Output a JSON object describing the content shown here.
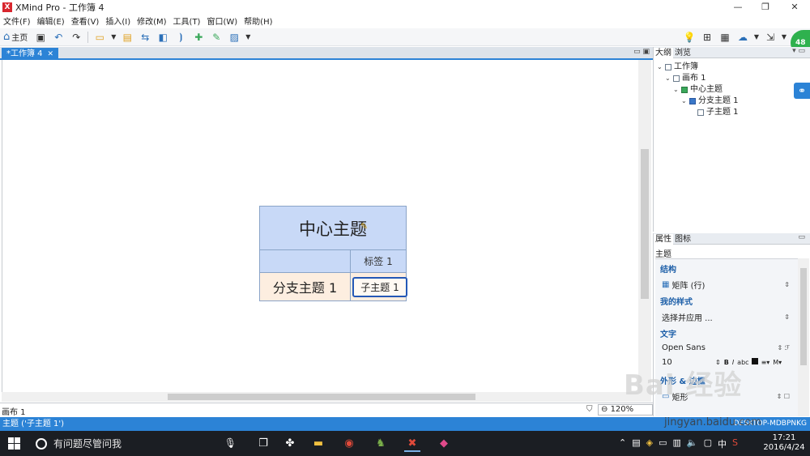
{
  "window": {
    "title": "XMind Pro - 工作簿 4",
    "logo": "X",
    "minimize": "—",
    "maximize": "❐",
    "close": "✕"
  },
  "menu": [
    "文件(F)",
    "编辑(E)",
    "查看(V)",
    "插入(I)",
    "修改(M)",
    "工具(T)",
    "窗口(W)",
    "帮助(H)"
  ],
  "toolbar": {
    "home_label": "主页",
    "badge": "48"
  },
  "editor": {
    "tab_label": "*工作簿 4",
    "central_topic": "中心主题",
    "label": "标签 1",
    "branch_topic": "分支主题 1",
    "sub_topic": "子主题 1"
  },
  "sheetbar": {
    "sheet": "画布 1",
    "zoom": "120%"
  },
  "status": {
    "text": "主题 ('子主题 1')",
    "right": "DESKTOP-MDBPNKG"
  },
  "outline": {
    "tab_outline": "大纲",
    "tab_browse": "浏览",
    "items": [
      {
        "label": "工作簿",
        "level": 0
      },
      {
        "label": "画布 1",
        "level": 1
      },
      {
        "label": "中心主题",
        "level": 2
      },
      {
        "label": "分支主题 1",
        "level": 3
      },
      {
        "label": "子主题 1",
        "level": 4
      }
    ]
  },
  "props": {
    "tab_props": "属性",
    "tab_icons": "图标",
    "subject": "主题",
    "structure_heading": "结构",
    "structure_value": "矩阵 (行)",
    "mystyle_heading": "我的样式",
    "mystyle_value": "选择并应用 ...",
    "text_heading": "文字",
    "font_value": "Open Sans",
    "size_value": "10",
    "shape_heading": "外形 & 边框",
    "shape_value": "矩形"
  },
  "watermark": {
    "logo": "Bai 经验",
    "url": "jingyan.baidu.com"
  },
  "taskbar": {
    "search_placeholder": "有问题尽管问我",
    "time": "17:21",
    "date": "2016/4/24",
    "ime": "中"
  },
  "colors": {
    "accent": "#2c83d6",
    "central_fill": "#c8d9f7",
    "branch_fill": "#fdeee0",
    "selection": "#2458b6",
    "taskbar": "#1b1e23"
  }
}
